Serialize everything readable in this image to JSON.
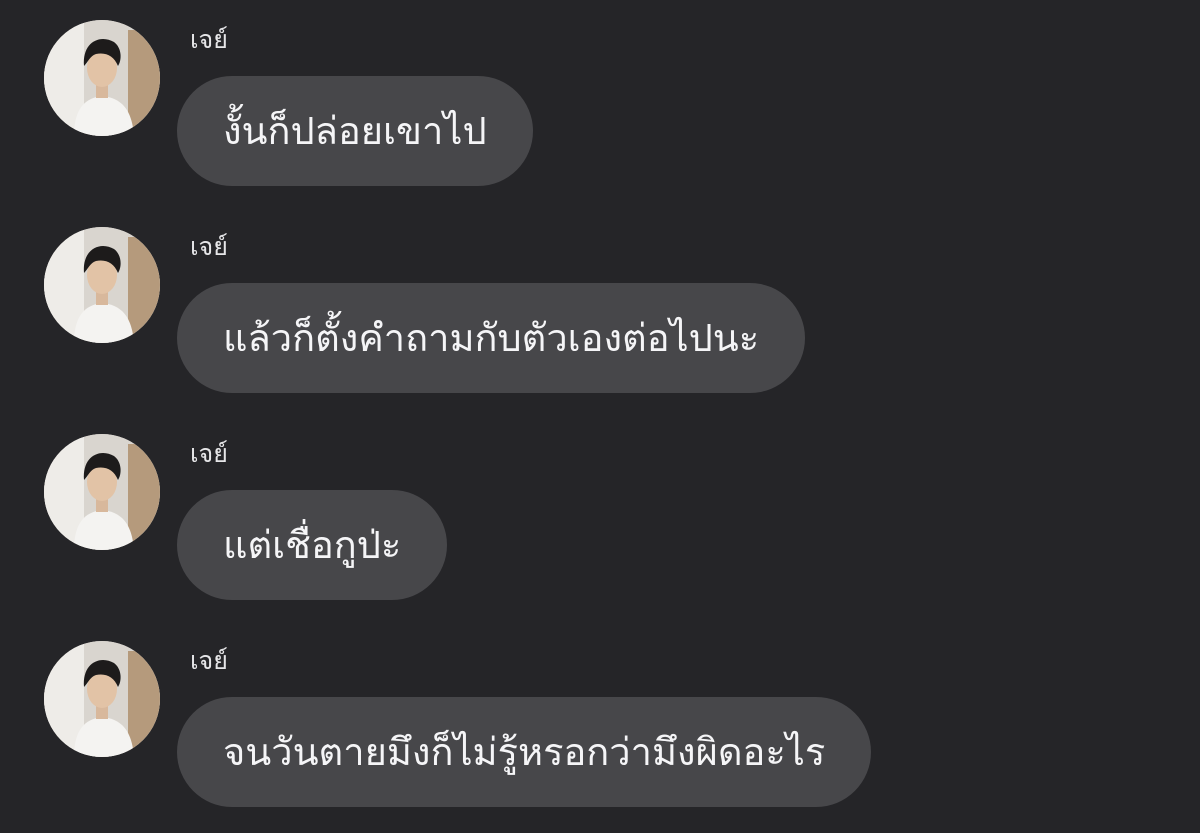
{
  "messages": [
    {
      "sender": "เจย์",
      "text": "งั้นก็ปล่อยเขาไป"
    },
    {
      "sender": "เจย์",
      "text": "แล้วก็ตั้งคำถามกับตัวเองต่อไปนะ"
    },
    {
      "sender": "เจย์",
      "text": "แต่เชื่อกูป่ะ"
    },
    {
      "sender": "เจย์",
      "text": "จนวันตายมึงก็ไม่รู้หรอกว่ามึงผิดอะไร"
    }
  ],
  "colors": {
    "background": "#252528",
    "bubble": "#47474a",
    "text": "#f5f5f7",
    "sender": "#e6e6e8"
  }
}
